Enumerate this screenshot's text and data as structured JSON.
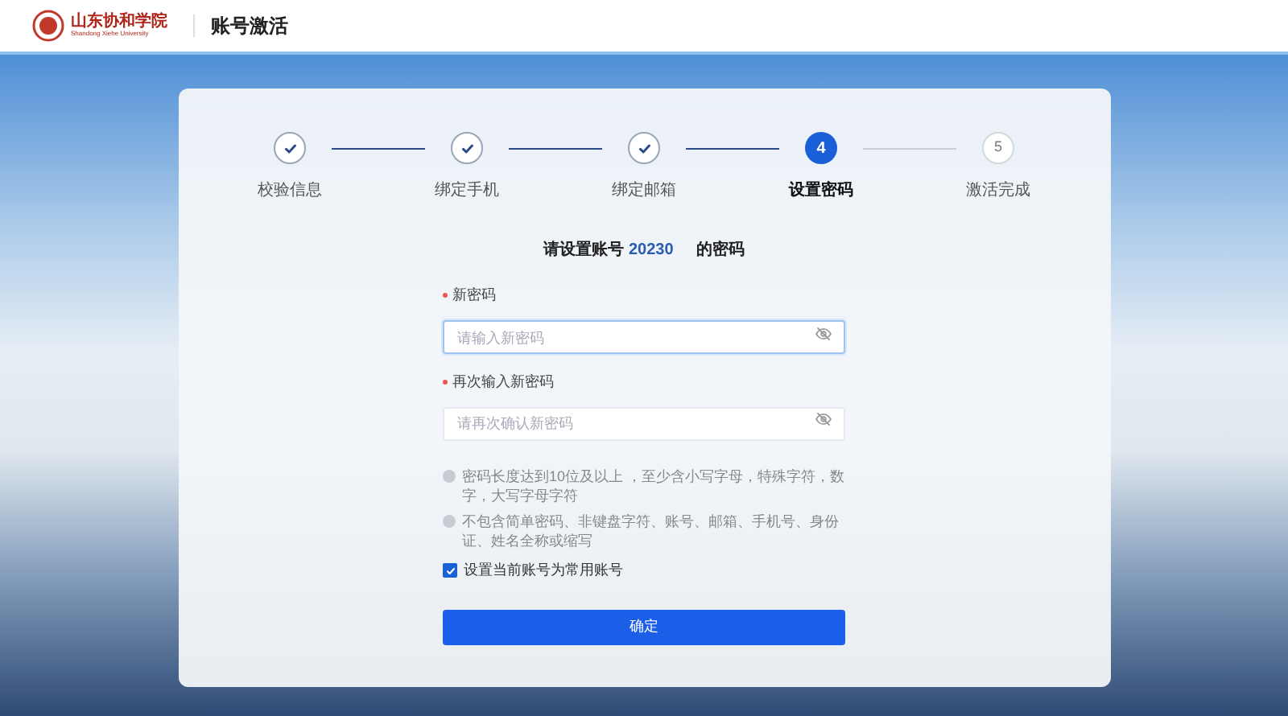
{
  "header": {
    "logo_name": "山东协和学院",
    "logo_subtitle": "Shandong Xiehe University",
    "title": "账号激活"
  },
  "steps": [
    {
      "label": "校验信息",
      "completed": true,
      "selected": false
    },
    {
      "label": "绑定手机",
      "completed": true,
      "selected": false
    },
    {
      "label": "绑定邮箱",
      "completed": true,
      "selected": false
    },
    {
      "number": "4",
      "label": "设置密码",
      "completed": false,
      "selected": true
    },
    {
      "number": "5",
      "label": "激活完成",
      "completed": false,
      "selected": false
    }
  ],
  "heading": {
    "before": "请设置账号",
    "account": "20230",
    "after": "的密码"
  },
  "fields": [
    {
      "label": "新密码",
      "required": true,
      "placeholder": "请输入新密码",
      "focused": true
    },
    {
      "label": "再次输入新密码",
      "required": true,
      "placeholder": "请再次确认新密码",
      "focused": false
    }
  ],
  "rules": [
    "密码长度达到10位及以上 ，至少含小写字母，特殊字符，数字，大写字母字符",
    "不包含简单密码、非键盘字符、账号、邮箱、手机号、身份证、姓名全称或缩写"
  ],
  "remember": {
    "label": "设置当前账号为常用账号",
    "checked": true
  },
  "submit": "确定"
}
